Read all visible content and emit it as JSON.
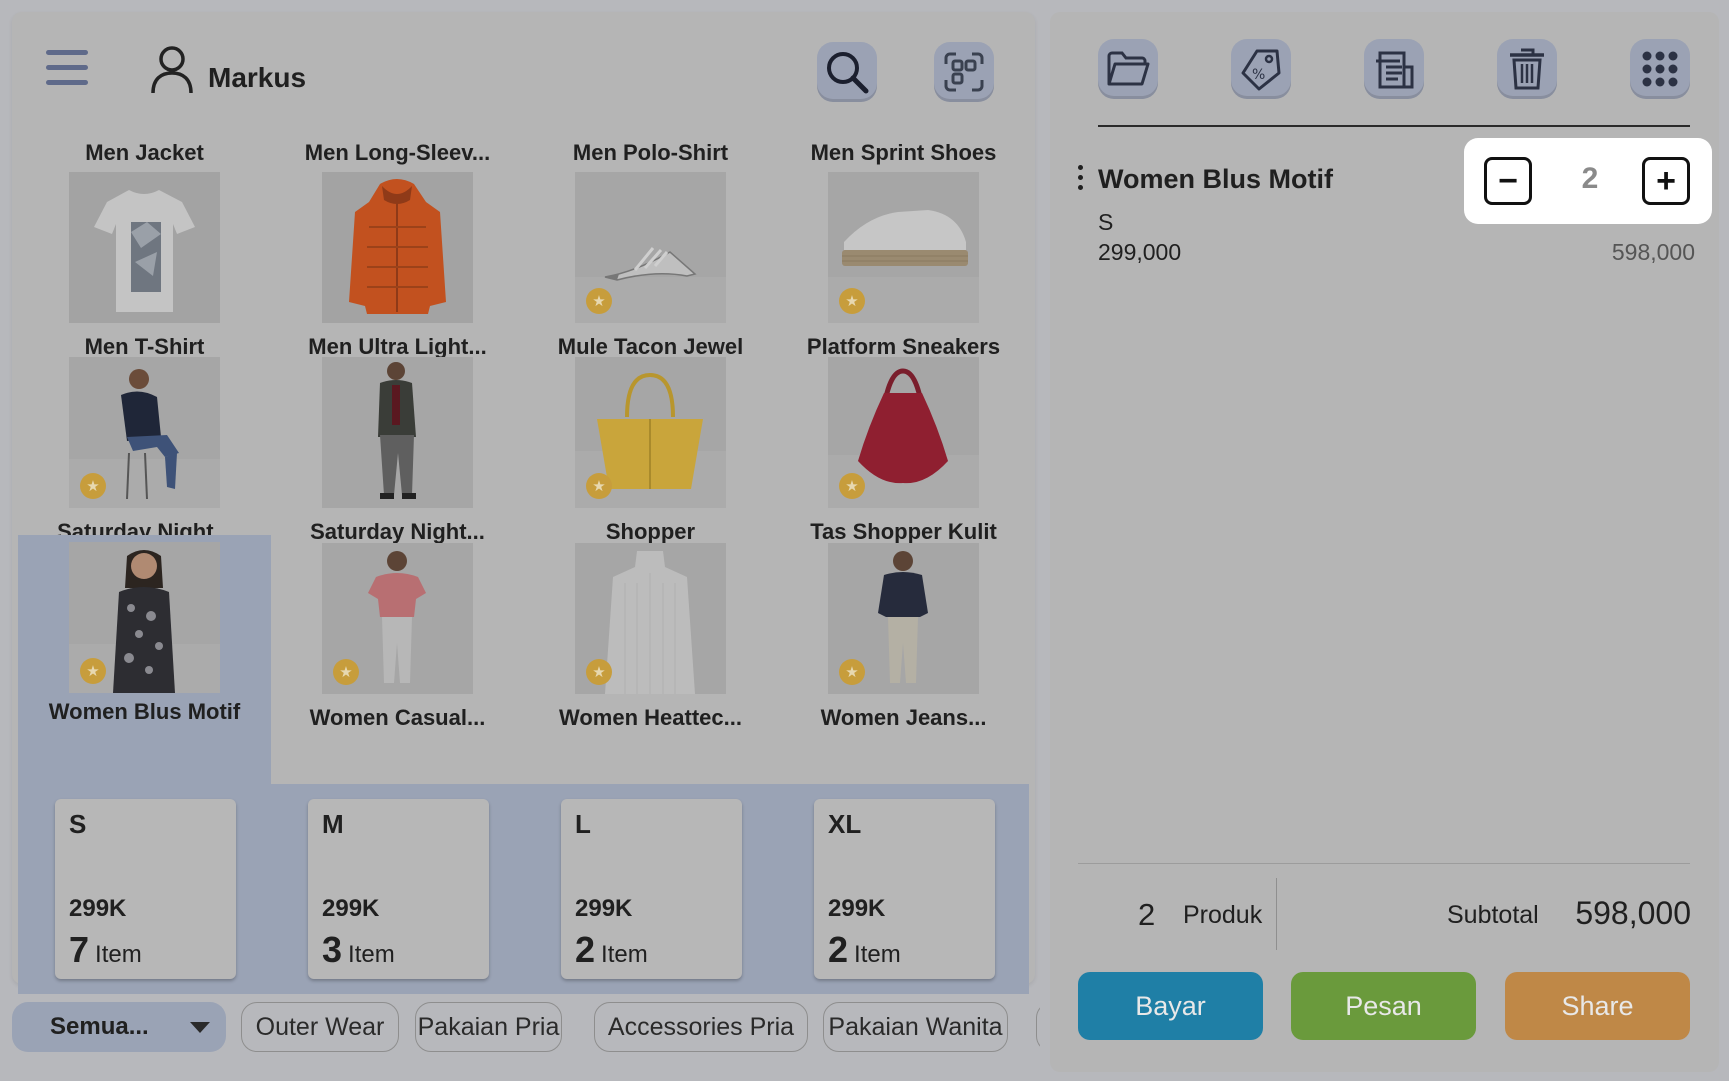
{
  "user": {
    "name": "Markus"
  },
  "header_row": [
    "Men Jacket",
    "Men Long-Sleev...",
    "Men Polo-Shirt",
    "Men Sprint Shoes"
  ],
  "products": [
    {
      "label": "Men T-Shirt",
      "image": "t-shirt",
      "favorite": false
    },
    {
      "label": "Men Ultra Light...",
      "image": "orange-down-jacket",
      "favorite": false
    },
    {
      "label": "Mule Tacon Jewel",
      "image": "heeled-mule",
      "favorite": true
    },
    {
      "label": "Platform Sneakers",
      "image": "white-sneaker",
      "favorite": true
    },
    {
      "label": "Saturday Night...",
      "image": "woman-sitting",
      "favorite": true
    },
    {
      "label": "Saturday Night...",
      "image": "man-coat",
      "favorite": false
    },
    {
      "label": "Shopper",
      "image": "yellow-tote-bag",
      "favorite": true
    },
    {
      "label": "Tas Shopper Kulit",
      "image": "red-leather-bag",
      "favorite": true
    },
    {
      "label": "Women Blus Motif",
      "image": "woman-patterned-blouse",
      "favorite": true,
      "selected": true
    },
    {
      "label": "Women Casual...",
      "image": "woman-pink-top",
      "favorite": true
    },
    {
      "label": "Women Heattec...",
      "image": "white-knit-top",
      "favorite": true
    },
    {
      "label": "Women Jeans...",
      "image": "woman-jeans",
      "favorite": true
    }
  ],
  "variants": [
    {
      "size": "S",
      "price": "299K",
      "count": "7",
      "unit": "Item"
    },
    {
      "size": "M",
      "price": "299K",
      "count": "3",
      "unit": "Item"
    },
    {
      "size": "L",
      "price": "299K",
      "count": "2",
      "unit": "Item"
    },
    {
      "size": "XL",
      "price": "299K",
      "count": "2",
      "unit": "Item"
    }
  ],
  "categories": {
    "selected": "Semua...",
    "chips": [
      "Outer Wear",
      "Pakaian Pria",
      "Accessories Pria",
      "Pakaian Wanita"
    ]
  },
  "toolbar_icons": [
    "folder-icon",
    "discount-tag-icon",
    "receipt-icon",
    "trash-icon",
    "more-dots-icon"
  ],
  "cart": {
    "line": {
      "name": "Women Blus Motif",
      "variant": "S",
      "unit_price": "299,000",
      "line_total": "598,000",
      "quantity": "2",
      "minus": "−",
      "plus": "+"
    },
    "summary": {
      "count": "2",
      "count_label": "Produk",
      "subtotal_label": "Subtotal",
      "subtotal": "598,000"
    }
  },
  "actions": {
    "pay": "Bayar",
    "order": "Pesan",
    "share": "Share"
  },
  "colors": {
    "pay": "#1f7fa6",
    "order": "#6a9a3c",
    "share": "#bf8847",
    "selection": "#9aa3b5",
    "star": "#c79d3c"
  }
}
